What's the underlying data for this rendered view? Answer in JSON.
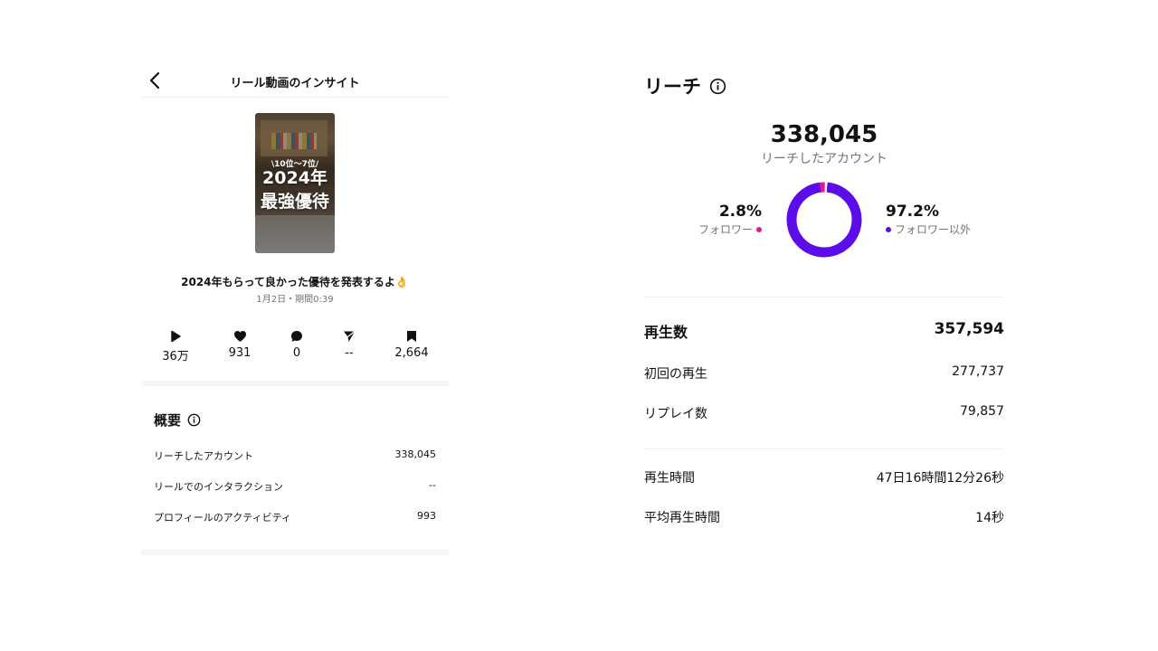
{
  "left_panel": {
    "header": {
      "title": "リール動画のインサイト"
    },
    "thumbnail": {
      "overlay_subtitle": "\\10位〜7位/",
      "overlay_line1": "2024年",
      "overlay_line2": "最強優待"
    },
    "post": {
      "caption": "2024年もらって良かった優待を発表するよ👌",
      "meta": "1月2日・期間0:39"
    },
    "stats": [
      {
        "icon": "play-icon",
        "value": "36万"
      },
      {
        "icon": "heart-icon",
        "value": "931"
      },
      {
        "icon": "comment-icon",
        "value": "0"
      },
      {
        "icon": "share-icon",
        "value": "--"
      },
      {
        "icon": "bookmark-icon",
        "value": "2,664"
      }
    ],
    "overview": {
      "title": "概要",
      "rows": [
        {
          "label": "リーチしたアカウント",
          "value": "338,045"
        },
        {
          "label": "リールでのインタラクション",
          "value": "--"
        },
        {
          "label": "プロフィールのアクティビティ",
          "value": "993"
        }
      ]
    }
  },
  "right_panel": {
    "title": "リーチ",
    "total": "338,045",
    "total_label": "リーチしたアカウント",
    "followers": {
      "percent": "2.8%",
      "label": "フォロワー",
      "fraction": 0.028,
      "color": "#e1198f"
    },
    "non_followers": {
      "percent": "97.2%",
      "label": "フォロワー以外",
      "fraction": 0.972,
      "color": "#5b0ce8"
    },
    "plays": {
      "label": "再生数",
      "value": "357,594",
      "rows": [
        {
          "label": "初回の再生",
          "value": "277,737"
        },
        {
          "label": "リプレイ数",
          "value": "79,857"
        }
      ]
    },
    "watch": [
      {
        "label": "再生時間",
        "value": "47日16時間12分26秒"
      },
      {
        "label": "平均再生時間",
        "value": "14秒"
      }
    ]
  }
}
